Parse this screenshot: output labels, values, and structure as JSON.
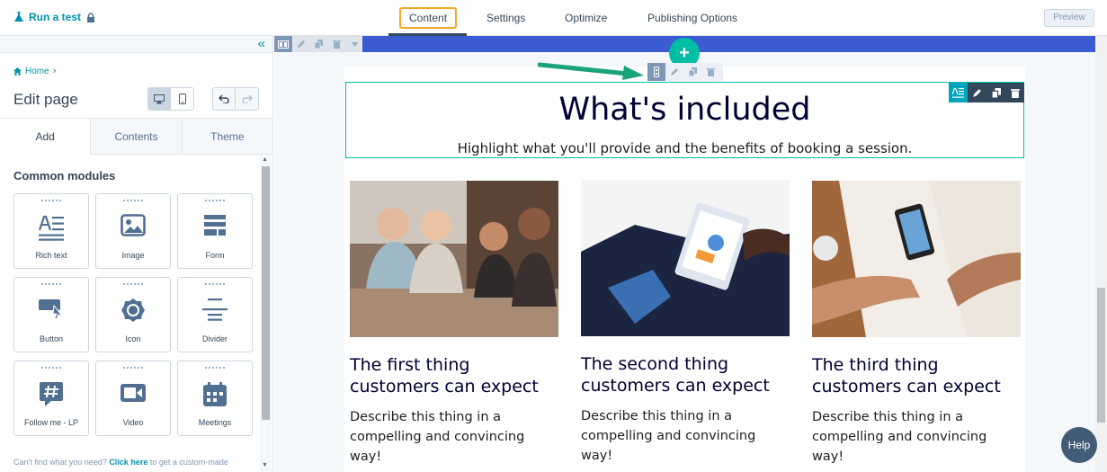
{
  "topbar": {
    "run_test": "Run a test",
    "tabs": [
      "Content",
      "Settings",
      "Optimize",
      "Publishing Options"
    ],
    "active_tab": "Content",
    "preview": "Preview"
  },
  "sidebar": {
    "breadcrumb": "Home",
    "title": "Edit page",
    "tabs": [
      "Add",
      "Contents",
      "Theme"
    ],
    "active_tab": "Add",
    "section_title": "Common modules",
    "modules": [
      "Rich text",
      "Image",
      "Form",
      "Button",
      "Icon",
      "Divider",
      "Follow me - LP",
      "Video",
      "Meetings"
    ],
    "footer_text": "Can't find what you need?",
    "footer_link": "Click here",
    "footer_rest": "to get a custom-made"
  },
  "page": {
    "headline": "What's included",
    "subline": "Highlight what you'll provide and the benefits of booking a session.",
    "columns": [
      {
        "title": "The first thing customers can expect",
        "text": "Describe this thing in a compelling and convincing way!"
      },
      {
        "title": "The second thing customers can expect",
        "text": "Describe this thing in a compelling and convincing way!"
      },
      {
        "title": "The third thing customers can expect",
        "text": "Describe this thing in a compelling and convincing way!"
      }
    ]
  },
  "help": "Help",
  "colors": {
    "accent": "#0091ae",
    "teal": "#00bda5",
    "tab_highlight": "#f5a623",
    "section_bar": "#3b5bd1",
    "arrow": "#1aa37a"
  }
}
